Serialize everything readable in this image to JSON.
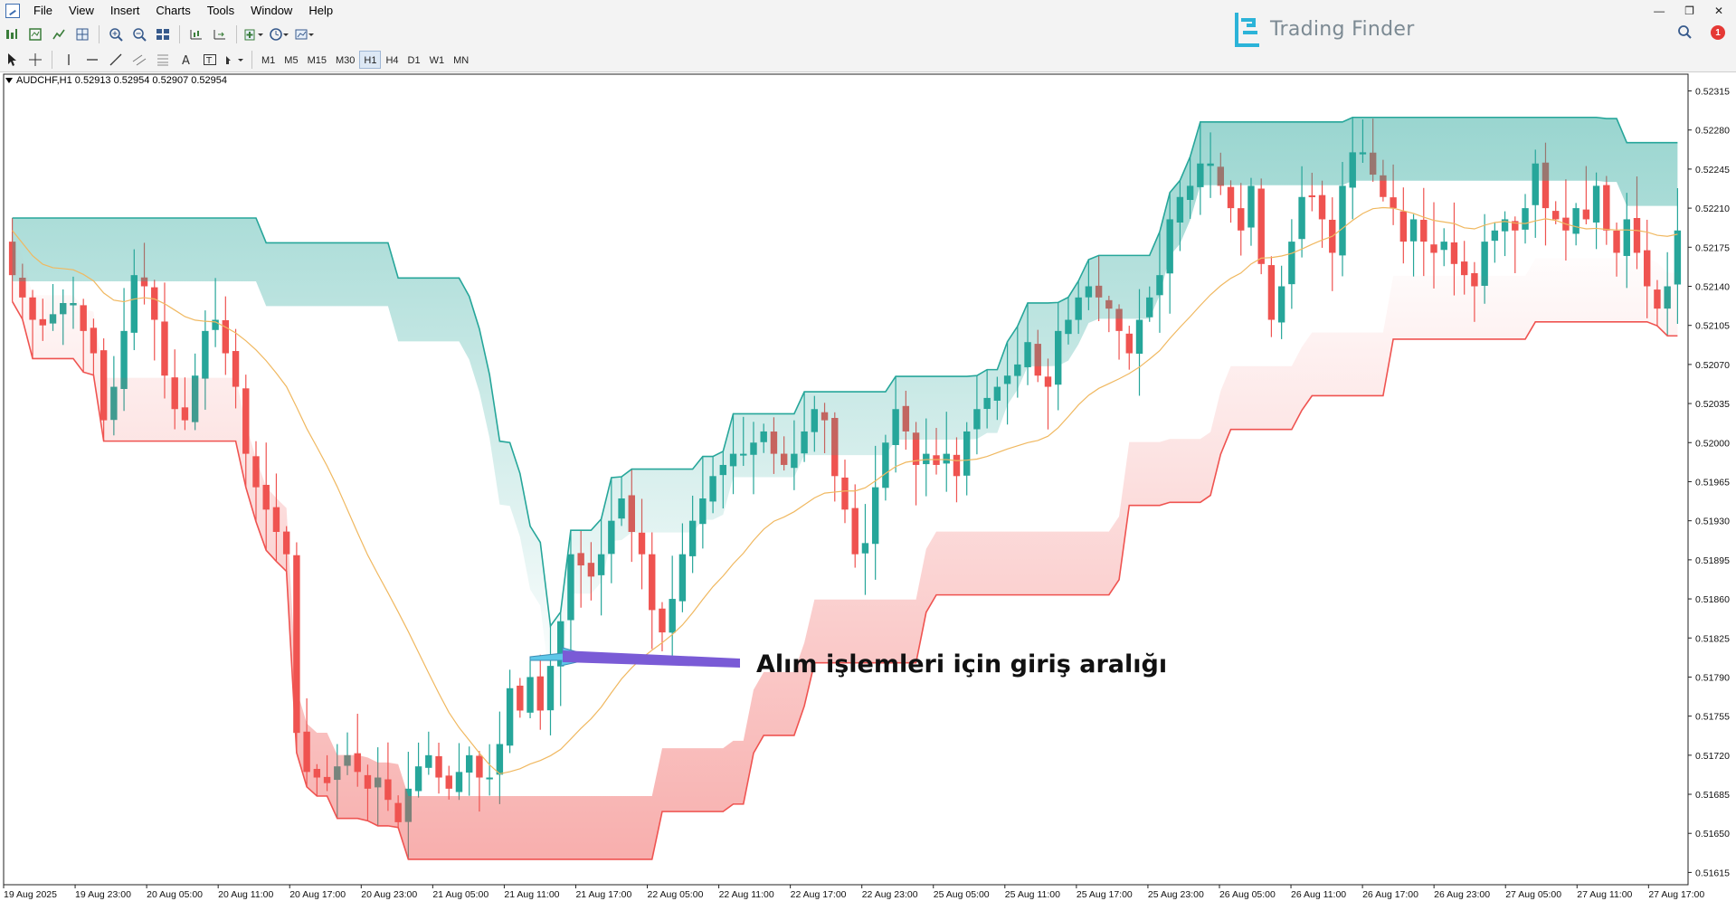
{
  "menu": [
    "File",
    "View",
    "Insert",
    "Charts",
    "Tools",
    "Window",
    "Help"
  ],
  "brand": {
    "name": "Trading Finder"
  },
  "notifications": {
    "count": "1"
  },
  "timeframes": [
    "M1",
    "M5",
    "M15",
    "M30",
    "H1",
    "H4",
    "D1",
    "W1",
    "MN"
  ],
  "active_timeframe": "H1",
  "symbol_info": "AUDCHF,H1  0.52913 0.52954 0.52907 0.52954",
  "annotation": "Alım işlemleri için giriş aralığı",
  "colors": {
    "bull": "#26a69a",
    "bear": "#ef5350",
    "ma": "#f0b860",
    "arrow": "#6b4fd8"
  },
  "chart_data": {
    "type": "candlestick",
    "symbol": "AUDCHF",
    "timeframe": "H1",
    "y_ticks": [
      "0.52315",
      "0.52280",
      "0.52245",
      "0.52210",
      "0.52175",
      "0.52140",
      "0.52105",
      "0.52070",
      "0.52035",
      "0.52000",
      "0.51965",
      "0.51930",
      "0.51895",
      "0.51860",
      "0.51825",
      "0.51790",
      "0.51755",
      "0.51720",
      "0.51685",
      "0.51650",
      "0.51615"
    ],
    "ylim": [
      0.51604,
      0.5233
    ],
    "x_ticks": [
      "19 Aug 2025",
      "19 Aug 23:00",
      "20 Aug 05:00",
      "20 Aug 11:00",
      "20 Aug 17:00",
      "20 Aug 23:00",
      "21 Aug 05:00",
      "21 Aug 11:00",
      "21 Aug 17:00",
      "22 Aug 05:00",
      "22 Aug 11:00",
      "22 Aug 17:00",
      "22 Aug 23:00",
      "25 Aug 05:00",
      "25 Aug 11:00",
      "25 Aug 17:00",
      "25 Aug 23:00",
      "26 Aug 05:00",
      "26 Aug 11:00",
      "26 Aug 17:00",
      "26 Aug 23:00",
      "27 Aug 05:00",
      "27 Aug 11:00",
      "27 Aug 17:00"
    ],
    "current_price": 0.52954,
    "closes": [
      0.5215,
      0.5213,
      0.5211,
      0.52105,
      0.52115,
      0.52125,
      0.52125,
      0.521,
      0.5208,
      0.5202,
      0.5205,
      0.521,
      0.5215,
      0.5214,
      0.5211,
      0.5206,
      0.5203,
      0.5202,
      0.5206,
      0.521,
      0.5211,
      0.5208,
      0.5205,
      0.5199,
      0.5196,
      0.5194,
      0.5192,
      0.519,
      0.5174,
      0.51705,
      0.517,
      0.51695,
      0.5171,
      0.5172,
      0.51705,
      0.5169,
      0.517,
      0.5168,
      0.5166,
      0.5169,
      0.5171,
      0.5172,
      0.517,
      0.5169,
      0.51705,
      0.5172,
      0.517,
      0.517,
      0.5173,
      0.5178,
      0.5176,
      0.5179,
      0.5176,
      0.518,
      0.5184,
      0.519,
      0.5189,
      0.5188,
      0.519,
      0.5193,
      0.5195,
      0.5192,
      0.519,
      0.5185,
      0.5183,
      0.5186,
      0.519,
      0.5193,
      0.5195,
      0.5197,
      0.5198,
      0.5199,
      0.5199,
      0.52,
      0.5201,
      0.5199,
      0.5198,
      0.5199,
      0.5201,
      0.5203,
      0.5202,
      0.5197,
      0.5194,
      0.519,
      0.5191,
      0.5196,
      0.52,
      0.5203,
      0.5201,
      0.5198,
      0.5199,
      0.5198,
      0.5199,
      0.5197,
      0.5201,
      0.5203,
      0.5204,
      0.5205,
      0.5206,
      0.5207,
      0.5209,
      0.5206,
      0.5205,
      0.521,
      0.5211,
      0.5213,
      0.5214,
      0.5213,
      0.5212,
      0.521,
      0.5208,
      0.5211,
      0.5213,
      0.5215,
      0.522,
      0.5222,
      0.5223,
      0.5225,
      0.5225,
      0.5223,
      0.5221,
      0.5219,
      0.5223,
      0.5216,
      0.5211,
      0.5214,
      0.5218,
      0.5222,
      0.5222,
      0.522,
      0.5217,
      0.5223,
      0.5226,
      0.5226,
      0.5224,
      0.5222,
      0.5221,
      0.5218,
      0.522,
      0.5218,
      0.5217,
      0.5218,
      0.5216,
      0.5215,
      0.5214,
      0.5218,
      0.5219,
      0.522,
      0.5219,
      0.5221,
      0.5225,
      0.5221,
      0.522,
      0.5219,
      0.5221,
      0.522,
      0.5223,
      0.5219,
      0.5217,
      0.522,
      0.5217,
      0.5214,
      0.5212,
      0.5214,
      0.5219
    ]
  }
}
